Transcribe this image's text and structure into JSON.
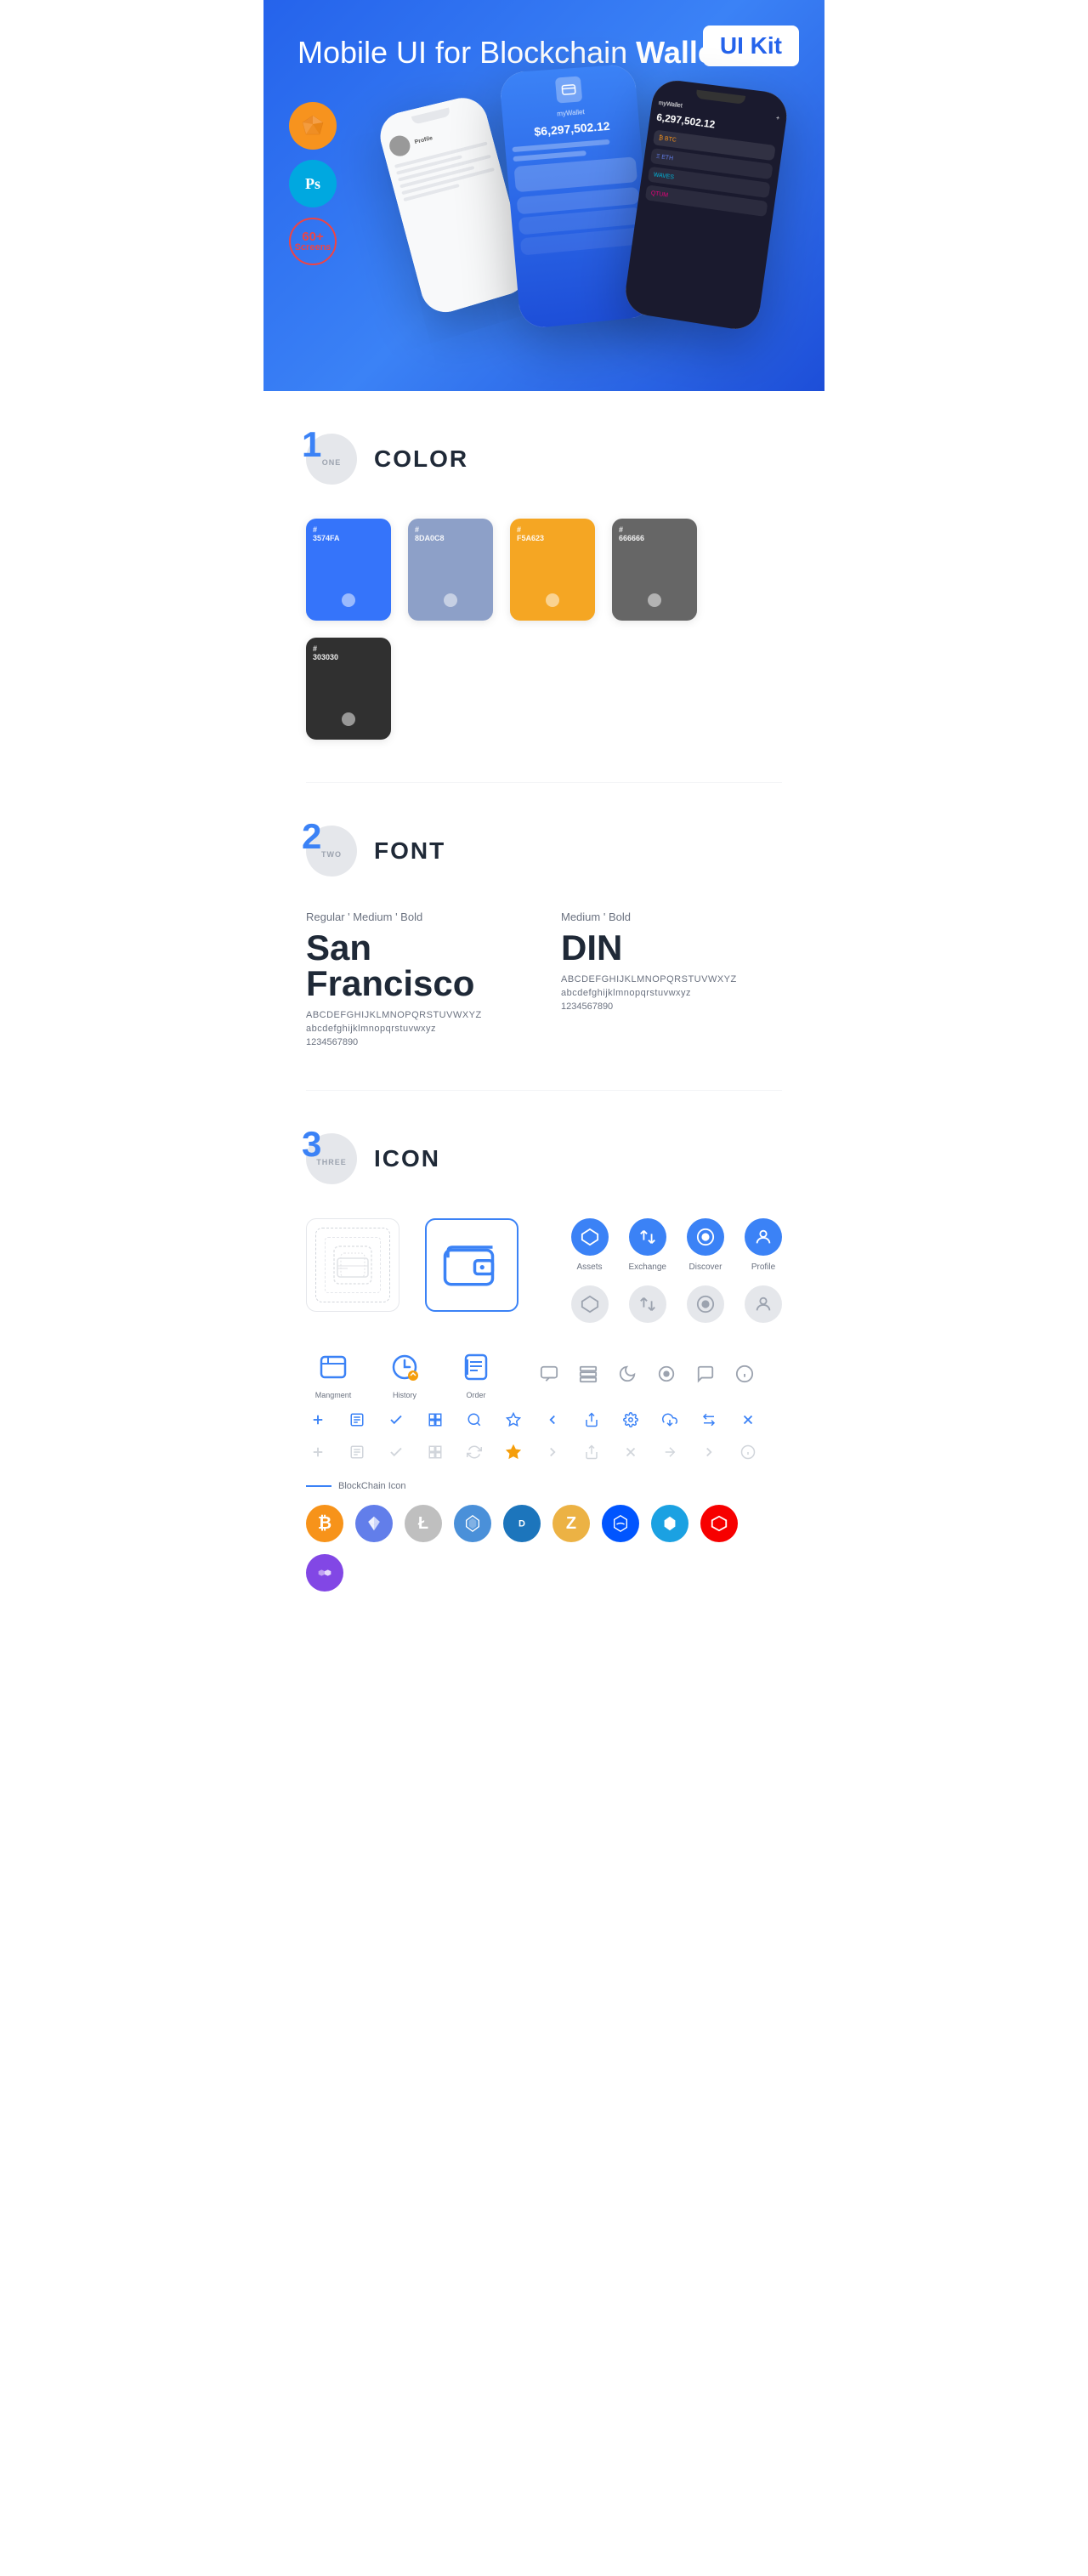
{
  "hero": {
    "title_regular": "Mobile UI for Blockchain ",
    "title_bold": "Wallet",
    "badge": "UI Kit",
    "sketch_label": "Sketch",
    "ps_label": "PS",
    "screens_count": "60+",
    "screens_label": "Screens"
  },
  "sections": {
    "color": {
      "number": "1",
      "word": "ONE",
      "title": "COLOR",
      "swatches": [
        {
          "hex": "#3574FA",
          "code": "#3574FA",
          "label": "3574FA"
        },
        {
          "hex": "#8DA0C8",
          "code": "#8DA0C8",
          "label": "8DA0C8"
        },
        {
          "hex": "#F5A623",
          "code": "#F5A623",
          "label": "F5A623"
        },
        {
          "hex": "#666666",
          "code": "#666666",
          "label": "666666"
        },
        {
          "hex": "#303030",
          "code": "#303030",
          "label": "303030"
        }
      ]
    },
    "font": {
      "number": "2",
      "word": "TWO",
      "title": "FONT",
      "font1": {
        "meta": "Regular ' Medium ' Bold",
        "name": "San Francisco",
        "uppercase": "ABCDEFGHIJKLMNOPQRSTUVWXYZ",
        "lowercase": "abcdefghijklmnopqrstuvwxyz",
        "numbers": "1234567890"
      },
      "font2": {
        "meta": "Medium ' Bold",
        "name": "DIN",
        "uppercase": "ABCDEFGHIJKLMNOPQRSTUVWXYZ",
        "lowercase": "abcdefghijklmnopqrstuvwxyz",
        "numbers": "1234567890"
      }
    },
    "icon": {
      "number": "3",
      "word": "THREE",
      "title": "ICON",
      "nav_icons": [
        {
          "label": "Assets",
          "icon": "◆"
        },
        {
          "label": "Exchange",
          "icon": "⇄"
        },
        {
          "label": "Discover",
          "icon": "●"
        },
        {
          "label": "Profile",
          "icon": "⌖"
        }
      ],
      "app_icons": [
        {
          "label": "Mangment",
          "icon": "management"
        },
        {
          "label": "History",
          "icon": "history"
        },
        {
          "label": "Order",
          "icon": "order"
        }
      ],
      "utility_icons_row1": [
        "□",
        "≡",
        "✓",
        "⊞",
        "🔍",
        "☆",
        "‹",
        "⟨",
        "⚙",
        "⬡",
        "⬌",
        "✕"
      ],
      "utility_icons_row2": [
        "+",
        "📋",
        "✓",
        "⊞",
        "↺",
        "★",
        "›",
        "⇒",
        "×",
        "→",
        "⟩",
        "ℹ"
      ],
      "blockchain_label": "BlockChain Icon",
      "crypto_icons": [
        {
          "symbol": "₿",
          "class": "crypto-btc",
          "name": "Bitcoin"
        },
        {
          "symbol": "Ξ",
          "class": "crypto-eth",
          "name": "Ethereum"
        },
        {
          "symbol": "Ł",
          "class": "crypto-ltc",
          "name": "Litecoin"
        },
        {
          "symbol": "◈",
          "class": "crypto-dash",
          "name": "NEM"
        },
        {
          "symbol": "D",
          "class": "crypto-dash",
          "name": "Dash"
        },
        {
          "symbol": "Z",
          "class": "crypto-zec",
          "name": "Zcash"
        },
        {
          "symbol": "⬡",
          "class": "crypto-waves",
          "name": "Waves"
        },
        {
          "symbol": "▲",
          "class": "crypto-strat",
          "name": "Stratis"
        },
        {
          "symbol": "◆",
          "class": "crypto-ark",
          "name": "Ark"
        },
        {
          "symbol": "⬡",
          "class": "crypto-matic",
          "name": "Matic"
        }
      ]
    }
  }
}
